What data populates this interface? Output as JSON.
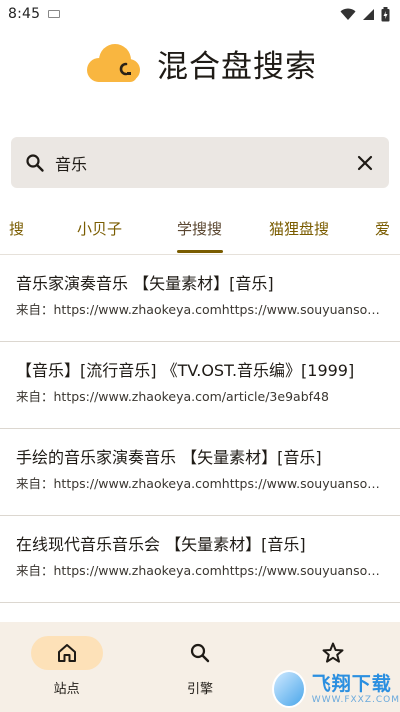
{
  "status_bar": {
    "time": "8:45"
  },
  "header": {
    "title": "混合盘搜索"
  },
  "search": {
    "value": "音乐"
  },
  "tabs": [
    {
      "label": "搜",
      "active": false
    },
    {
      "label": "小贝子",
      "active": false
    },
    {
      "label": "学搜搜",
      "active": true
    },
    {
      "label": "猫狸盘搜",
      "active": false
    },
    {
      "label": "爱",
      "active": false
    }
  ],
  "results": [
    {
      "title": "音乐家演奏音乐 【矢量素材】[音乐]",
      "source": "来自：https://www.zhaokeya.comhttps://www.souyuansou.com"
    },
    {
      "title": "【音乐】[流行音乐] 《TV.OST.音乐编》[1999]",
      "source": "来自：https://www.zhaokeya.com/article/3e9abf48"
    },
    {
      "title": "手绘的音乐家演奏音乐 【矢量素材】[音乐]",
      "source": "来自：https://www.zhaokeya.comhttps://www.souyuansou.com"
    },
    {
      "title": "在线现代音乐音乐会 【矢量素材】[音乐]",
      "source": "来自：https://www.zhaokeya.comhttps://www.souyuansou.com"
    }
  ],
  "bottom_nav": [
    {
      "label": "站点",
      "icon": "home-icon",
      "active": true
    },
    {
      "label": "引擎",
      "icon": "search-icon",
      "active": false
    },
    {
      "label": "",
      "icon": "star-icon",
      "active": false
    }
  ],
  "watermark": {
    "main": "飞翔下载",
    "sub": "WWW.FXXZ.COM"
  },
  "colors": {
    "accent": "#7a5c00",
    "logo": "#f9b640",
    "search_bg": "#ebe7e3",
    "nav_bg": "#f6efe6",
    "nav_active_pill": "#fde1b8"
  }
}
